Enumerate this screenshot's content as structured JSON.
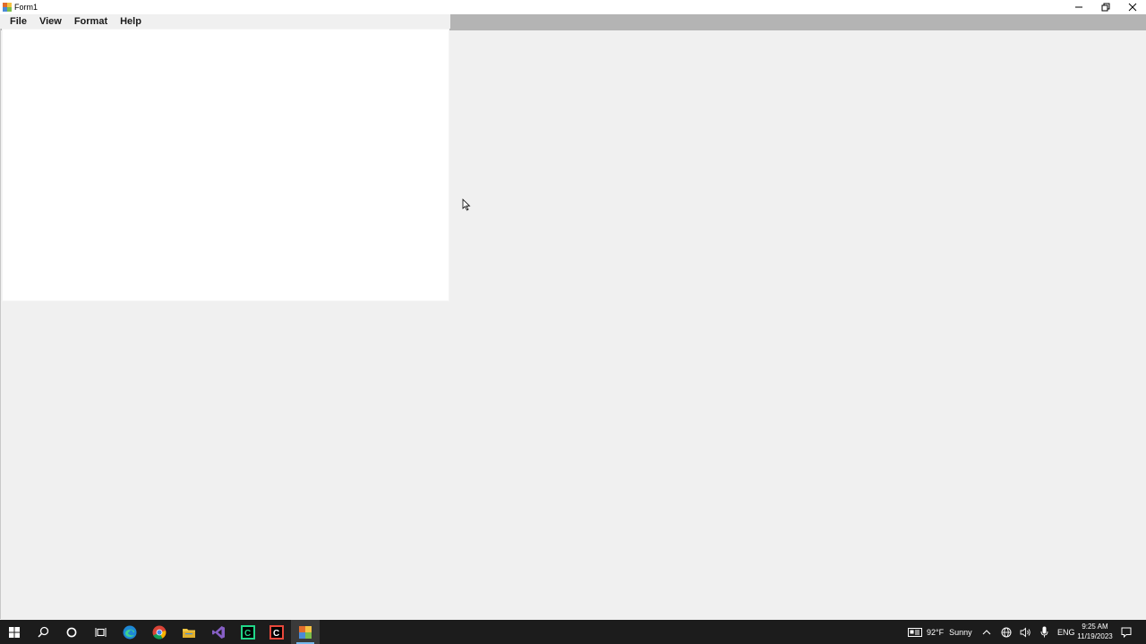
{
  "window": {
    "title": "Form1"
  },
  "menu": {
    "items": [
      {
        "label": "File"
      },
      {
        "label": "View"
      },
      {
        "label": "Format"
      },
      {
        "label": "Help"
      }
    ]
  },
  "editor": {
    "content": ""
  },
  "taskbar": {
    "apps": [
      {
        "icon": "start-icon"
      },
      {
        "icon": "search-icon"
      },
      {
        "icon": "cortana-icon"
      },
      {
        "icon": "task-view-icon"
      },
      {
        "icon": "edge-icon"
      },
      {
        "icon": "chrome-icon"
      },
      {
        "icon": "file-explorer-icon"
      },
      {
        "icon": "visual-studio-icon"
      },
      {
        "icon": "clion-icon"
      },
      {
        "icon": "codeblocks-icon"
      },
      {
        "icon": "form-app-icon"
      }
    ],
    "weather": {
      "temperature": "92°F",
      "condition": "Sunny"
    },
    "language": "ENG",
    "time": "9:25 AM",
    "date": "11/19/2023"
  },
  "colors": {
    "taskbar_bg": "#1c1c1c",
    "active_underline": "#76b9ed",
    "menustrip_bg": "#b4b4b4",
    "window_bg": "#f0f0f0"
  }
}
